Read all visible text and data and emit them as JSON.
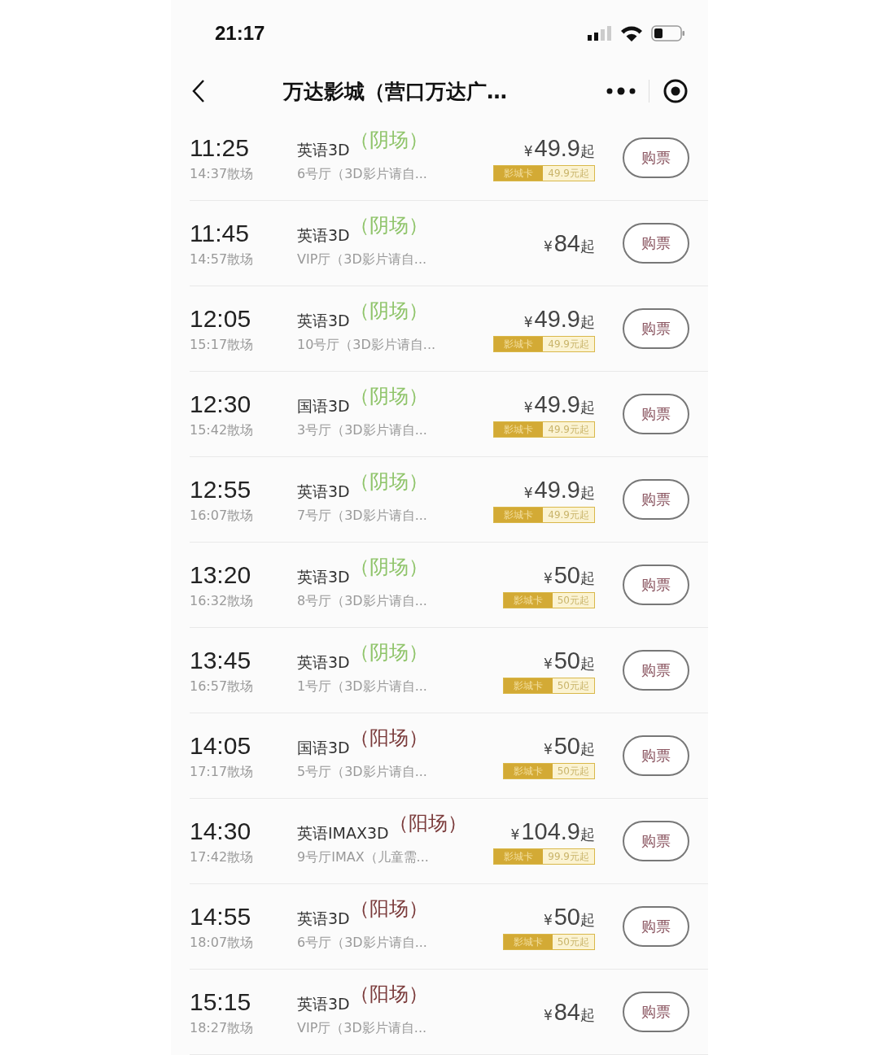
{
  "status_bar": {
    "time": "21:17"
  },
  "nav_bar": {
    "title": "万达影城（营口万达广…"
  },
  "showtimes": [
    {
      "start": "11:25",
      "end": "14:37散场",
      "version": "英语3D",
      "tag": {
        "text": "（阴场）",
        "color": "#8fc46a"
      },
      "hall": "6号厅（3D影片请自...",
      "price": {
        "currency": "¥",
        "amount": "49.9",
        "suffix": "起"
      },
      "card": {
        "label": "影城卡",
        "price": "49.9元起"
      },
      "button": "购票"
    },
    {
      "start": "11:45",
      "end": "14:57散场",
      "version": "英语3D",
      "tag": {
        "text": "（阴场）",
        "color": "#8fc46a"
      },
      "hall": "VIP厅（3D影片请自...",
      "price": {
        "currency": "¥",
        "amount": "84",
        "suffix": "起"
      },
      "button": "购票"
    },
    {
      "start": "12:05",
      "end": "15:17散场",
      "version": "英语3D",
      "tag": {
        "text": "（阴场）",
        "color": "#8fc46a"
      },
      "hall": "10号厅（3D影片请自...",
      "price": {
        "currency": "¥",
        "amount": "49.9",
        "suffix": "起"
      },
      "card": {
        "label": "影城卡",
        "price": "49.9元起"
      },
      "button": "购票"
    },
    {
      "start": "12:30",
      "end": "15:42散场",
      "version": "国语3D",
      "tag": {
        "text": "（阴场）",
        "color": "#8fc46a"
      },
      "hall": "3号厅（3D影片请自...",
      "price": {
        "currency": "¥",
        "amount": "49.9",
        "suffix": "起"
      },
      "card": {
        "label": "影城卡",
        "price": "49.9元起"
      },
      "button": "购票"
    },
    {
      "start": "12:55",
      "end": "16:07散场",
      "version": "英语3D",
      "tag": {
        "text": "（阴场）",
        "color": "#8fc46a"
      },
      "hall": "7号厅（3D影片请自...",
      "price": {
        "currency": "¥",
        "amount": "49.9",
        "suffix": "起"
      },
      "card": {
        "label": "影城卡",
        "price": "49.9元起"
      },
      "button": "购票"
    },
    {
      "start": "13:20",
      "end": "16:32散场",
      "version": "英语3D",
      "tag": {
        "text": "（阴场）",
        "color": "#8fc46a"
      },
      "hall": "8号厅（3D影片请自...",
      "price": {
        "currency": "¥",
        "amount": "50",
        "suffix": "起"
      },
      "card": {
        "label": "影城卡",
        "price": "50元起"
      },
      "button": "购票"
    },
    {
      "start": "13:45",
      "end": "16:57散场",
      "version": "英语3D",
      "tag": {
        "text": "（阴场）",
        "color": "#8fc46a"
      },
      "hall": "1号厅（3D影片请自...",
      "price": {
        "currency": "¥",
        "amount": "50",
        "suffix": "起"
      },
      "card": {
        "label": "影城卡",
        "price": "50元起"
      },
      "button": "购票"
    },
    {
      "start": "14:05",
      "end": "17:17散场",
      "version": "国语3D",
      "tag": {
        "text": "（阳场）",
        "color": "#7a3a3a"
      },
      "hall": "5号厅（3D影片请自...",
      "price": {
        "currency": "¥",
        "amount": "50",
        "suffix": "起"
      },
      "card": {
        "label": "影城卡",
        "price": "50元起"
      },
      "button": "购票"
    },
    {
      "start": "14:30",
      "end": "17:42散场",
      "version": "英语IMAX3D",
      "tag": {
        "text": "（阳场）",
        "color": "#7a3a3a"
      },
      "hall": "9号厅IMAX（儿童需...",
      "price": {
        "currency": "¥",
        "amount": "104.9",
        "suffix": "起"
      },
      "card": {
        "label": "影城卡",
        "price": "99.9元起"
      },
      "button": "购票"
    },
    {
      "start": "14:55",
      "end": "18:07散场",
      "version": "英语3D",
      "tag": {
        "text": "（阳场）",
        "color": "#7a3a3a"
      },
      "hall": "6号厅（3D影片请自...",
      "price": {
        "currency": "¥",
        "amount": "50",
        "suffix": "起"
      },
      "card": {
        "label": "影城卡",
        "price": "50元起"
      },
      "button": "购票"
    },
    {
      "start": "15:15",
      "end": "18:27散场",
      "version": "英语3D",
      "tag": {
        "text": "（阳场）",
        "color": "#7a3a3a"
      },
      "hall": "VIP厅（3D影片请自...",
      "price": {
        "currency": "¥",
        "amount": "84",
        "suffix": "起"
      },
      "button": "购票"
    }
  ]
}
